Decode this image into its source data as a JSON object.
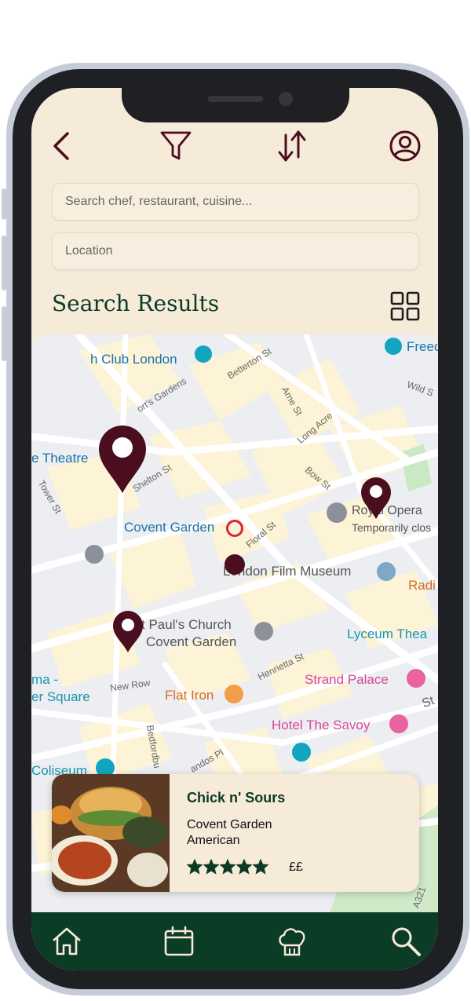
{
  "header": {
    "back_icon": "chevron-left-icon",
    "filter_icon": "funnel-icon",
    "sort_icon": "sort-arrows-icon",
    "profile_icon": "user-circle-icon"
  },
  "search": {
    "query_placeholder": "Search chef, restaurant, cuisine...",
    "location_placeholder": "Location"
  },
  "results": {
    "title": "Search Results",
    "view_toggle_icon": "grid-view-icon"
  },
  "map": {
    "places": {
      "club": "h Club London",
      "freed": "Freed",
      "theatre": "e Theatre",
      "covent_garden": "Covent Garden",
      "royal_opera": "Royal Opera",
      "temporarily": "Temporarily clos",
      "film_museum": "London Film Museum",
      "radio": "Radi",
      "st_pauls_1": "t Paul's Church",
      "st_pauls_2": "Covent Garden",
      "lyceum": "Lyceum Thea",
      "strand_palace": "Strand Palace",
      "flat_iron": "Flat Iron",
      "savoy": "Hotel The Savoy",
      "cinema_1": "ma -",
      "cinema_2": "er Square",
      "coliseum": "Coliseum"
    },
    "streets": {
      "betterton": "Betterton St",
      "gardens": "ort's Gardens",
      "shelton": "Shelton St",
      "arne": "Arne St",
      "long_acre": "Long Acre",
      "wild": "Wild S",
      "tower": "Tower St",
      "bow": "Bow St",
      "floral": "Floral St",
      "henrietta": "Henrietta St",
      "new_row": "New Row",
      "bedford": "Bedfordbu",
      "chandos": "andos Pl",
      "a321": "A321",
      "st": "St"
    }
  },
  "card": {
    "name": "Chick n' Sours",
    "area": "Covent Garden",
    "cuisine": "American",
    "rating": 5,
    "rating_max": 5,
    "price": "££"
  },
  "nav": {
    "home_icon": "home-icon",
    "calendar_icon": "calendar-icon",
    "chef_icon": "chef-hat-icon",
    "search_icon": "search-icon"
  },
  "colors": {
    "accent_dark": "#4a0e1f",
    "brand_green": "#0b3c26",
    "background": "#f6ead9"
  }
}
